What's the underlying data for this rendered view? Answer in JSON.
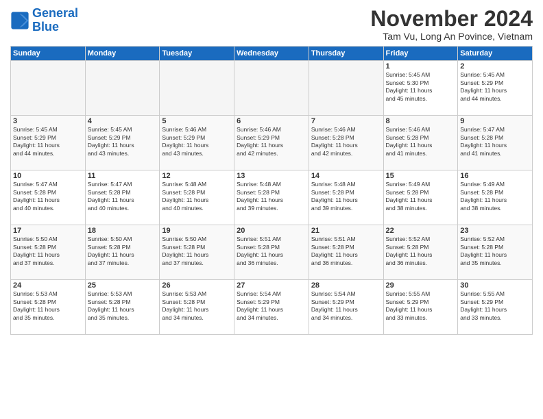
{
  "header": {
    "logo_line1": "General",
    "logo_line2": "Blue",
    "month": "November 2024",
    "location": "Tam Vu, Long An Povince, Vietnam"
  },
  "weekdays": [
    "Sunday",
    "Monday",
    "Tuesday",
    "Wednesday",
    "Thursday",
    "Friday",
    "Saturday"
  ],
  "weeks": [
    [
      {
        "day": "",
        "info": ""
      },
      {
        "day": "",
        "info": ""
      },
      {
        "day": "",
        "info": ""
      },
      {
        "day": "",
        "info": ""
      },
      {
        "day": "",
        "info": ""
      },
      {
        "day": "1",
        "info": "Sunrise: 5:45 AM\nSunset: 5:30 PM\nDaylight: 11 hours\nand 45 minutes."
      },
      {
        "day": "2",
        "info": "Sunrise: 5:45 AM\nSunset: 5:29 PM\nDaylight: 11 hours\nand 44 minutes."
      }
    ],
    [
      {
        "day": "3",
        "info": "Sunrise: 5:45 AM\nSunset: 5:29 PM\nDaylight: 11 hours\nand 44 minutes."
      },
      {
        "day": "4",
        "info": "Sunrise: 5:45 AM\nSunset: 5:29 PM\nDaylight: 11 hours\nand 43 minutes."
      },
      {
        "day": "5",
        "info": "Sunrise: 5:46 AM\nSunset: 5:29 PM\nDaylight: 11 hours\nand 43 minutes."
      },
      {
        "day": "6",
        "info": "Sunrise: 5:46 AM\nSunset: 5:29 PM\nDaylight: 11 hours\nand 42 minutes."
      },
      {
        "day": "7",
        "info": "Sunrise: 5:46 AM\nSunset: 5:28 PM\nDaylight: 11 hours\nand 42 minutes."
      },
      {
        "day": "8",
        "info": "Sunrise: 5:46 AM\nSunset: 5:28 PM\nDaylight: 11 hours\nand 41 minutes."
      },
      {
        "day": "9",
        "info": "Sunrise: 5:47 AM\nSunset: 5:28 PM\nDaylight: 11 hours\nand 41 minutes."
      }
    ],
    [
      {
        "day": "10",
        "info": "Sunrise: 5:47 AM\nSunset: 5:28 PM\nDaylight: 11 hours\nand 40 minutes."
      },
      {
        "day": "11",
        "info": "Sunrise: 5:47 AM\nSunset: 5:28 PM\nDaylight: 11 hours\nand 40 minutes."
      },
      {
        "day": "12",
        "info": "Sunrise: 5:48 AM\nSunset: 5:28 PM\nDaylight: 11 hours\nand 40 minutes."
      },
      {
        "day": "13",
        "info": "Sunrise: 5:48 AM\nSunset: 5:28 PM\nDaylight: 11 hours\nand 39 minutes."
      },
      {
        "day": "14",
        "info": "Sunrise: 5:48 AM\nSunset: 5:28 PM\nDaylight: 11 hours\nand 39 minutes."
      },
      {
        "day": "15",
        "info": "Sunrise: 5:49 AM\nSunset: 5:28 PM\nDaylight: 11 hours\nand 38 minutes."
      },
      {
        "day": "16",
        "info": "Sunrise: 5:49 AM\nSunset: 5:28 PM\nDaylight: 11 hours\nand 38 minutes."
      }
    ],
    [
      {
        "day": "17",
        "info": "Sunrise: 5:50 AM\nSunset: 5:28 PM\nDaylight: 11 hours\nand 37 minutes."
      },
      {
        "day": "18",
        "info": "Sunrise: 5:50 AM\nSunset: 5:28 PM\nDaylight: 11 hours\nand 37 minutes."
      },
      {
        "day": "19",
        "info": "Sunrise: 5:50 AM\nSunset: 5:28 PM\nDaylight: 11 hours\nand 37 minutes."
      },
      {
        "day": "20",
        "info": "Sunrise: 5:51 AM\nSunset: 5:28 PM\nDaylight: 11 hours\nand 36 minutes."
      },
      {
        "day": "21",
        "info": "Sunrise: 5:51 AM\nSunset: 5:28 PM\nDaylight: 11 hours\nand 36 minutes."
      },
      {
        "day": "22",
        "info": "Sunrise: 5:52 AM\nSunset: 5:28 PM\nDaylight: 11 hours\nand 36 minutes."
      },
      {
        "day": "23",
        "info": "Sunrise: 5:52 AM\nSunset: 5:28 PM\nDaylight: 11 hours\nand 35 minutes."
      }
    ],
    [
      {
        "day": "24",
        "info": "Sunrise: 5:53 AM\nSunset: 5:28 PM\nDaylight: 11 hours\nand 35 minutes."
      },
      {
        "day": "25",
        "info": "Sunrise: 5:53 AM\nSunset: 5:28 PM\nDaylight: 11 hours\nand 35 minutes."
      },
      {
        "day": "26",
        "info": "Sunrise: 5:53 AM\nSunset: 5:28 PM\nDaylight: 11 hours\nand 34 minutes."
      },
      {
        "day": "27",
        "info": "Sunrise: 5:54 AM\nSunset: 5:29 PM\nDaylight: 11 hours\nand 34 minutes."
      },
      {
        "day": "28",
        "info": "Sunrise: 5:54 AM\nSunset: 5:29 PM\nDaylight: 11 hours\nand 34 minutes."
      },
      {
        "day": "29",
        "info": "Sunrise: 5:55 AM\nSunset: 5:29 PM\nDaylight: 11 hours\nand 33 minutes."
      },
      {
        "day": "30",
        "info": "Sunrise: 5:55 AM\nSunset: 5:29 PM\nDaylight: 11 hours\nand 33 minutes."
      }
    ]
  ]
}
